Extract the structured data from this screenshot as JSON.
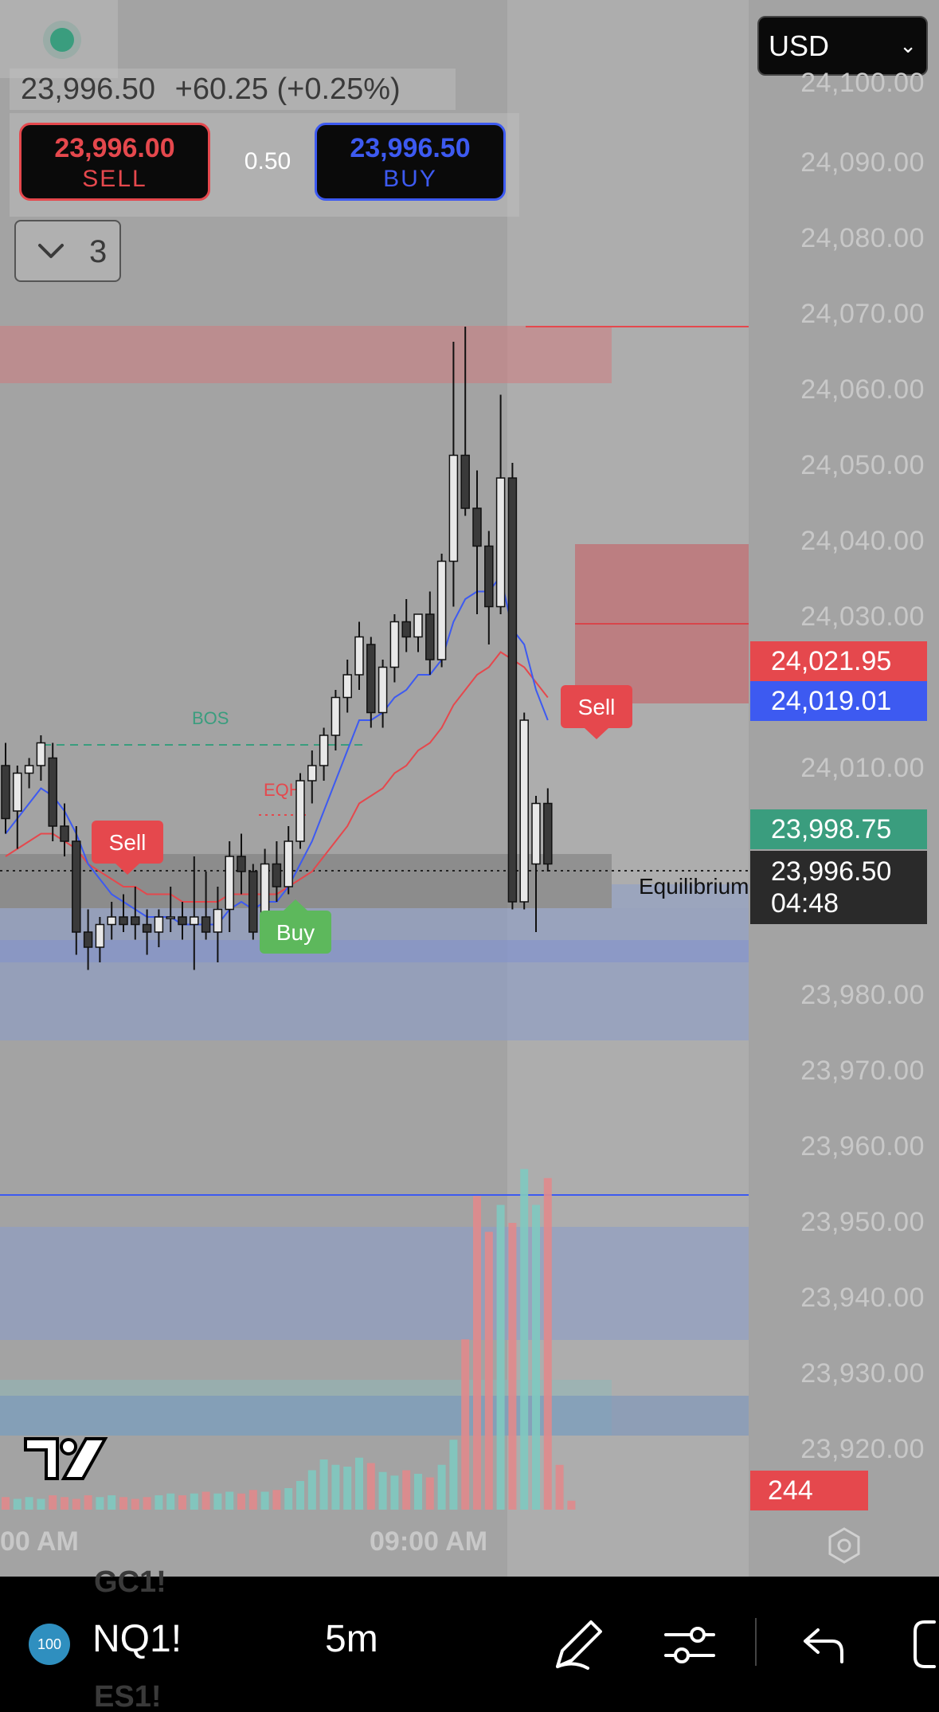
{
  "currency": {
    "value": "USD"
  },
  "quote": {
    "last": "23,996.50",
    "change": "+60.25 (+0.25%)"
  },
  "trade": {
    "sell_price": "23,996.00",
    "sell_label": "SELL",
    "spread": "0.50",
    "buy_price": "23,996.50",
    "buy_label": "BUY"
  },
  "layers": {
    "count": "3"
  },
  "price_axis": [
    "24,100.00",
    "24,090.00",
    "24,080.00",
    "24,070.00",
    "24,060.00",
    "24,050.00",
    "24,040.00",
    "24,030.00",
    "24,010.00",
    "23,980.00",
    "23,970.00",
    "23,960.00",
    "23,950.00",
    "23,940.00",
    "23,930.00",
    "23,920.00"
  ],
  "badges": {
    "red_ma": "24,021.95",
    "blue_ma": "24,019.01",
    "green_price": "23,998.75",
    "last_price": "23,996.50",
    "countdown": "04:48",
    "volume": "244"
  },
  "time_axis": {
    "left": "00 AM",
    "center": "09:00 AM"
  },
  "bottom_bar": {
    "symbol_badge": "100",
    "symbol": "NQ1!",
    "timeframe": "5m",
    "ghost_above": "GC1!",
    "ghost_below": "ES1!"
  },
  "colors": {
    "sell": "#e5484d",
    "buy": "#3d5af1",
    "up_green": "#3a9d7e",
    "background": "#a3a3a3"
  },
  "chart_data": {
    "type": "candlestick",
    "symbol": "NQ1!",
    "interval": "5m",
    "ylim": [
      23915,
      24105
    ],
    "annotations": [
      "BOS",
      "EQH",
      "Sell",
      "Buy",
      "Sell",
      "Equilibrium"
    ],
    "candles": [
      {
        "o": 24012,
        "h": 24015,
        "l": 24003,
        "c": 24005
      },
      {
        "o": 24006,
        "h": 24012,
        "l": 24001,
        "c": 24011
      },
      {
        "o": 24011,
        "h": 24013,
        "l": 24009,
        "c": 24012
      },
      {
        "o": 24012,
        "h": 24016,
        "l": 24010,
        "c": 24015
      },
      {
        "o": 24013,
        "h": 24015,
        "l": 24002,
        "c": 24004
      },
      {
        "o": 24004,
        "h": 24007,
        "l": 24000,
        "c": 24002
      },
      {
        "o": 24002,
        "h": 24004,
        "l": 23987,
        "c": 23990
      },
      {
        "o": 23990,
        "h": 23993,
        "l": 23985,
        "c": 23988
      },
      {
        "o": 23988,
        "h": 23992,
        "l": 23986,
        "c": 23991
      },
      {
        "o": 23991,
        "h": 23994,
        "l": 23989,
        "c": 23992
      },
      {
        "o": 23992,
        "h": 23995,
        "l": 23990,
        "c": 23991
      },
      {
        "o": 23992,
        "h": 23996,
        "l": 23989,
        "c": 23991
      },
      {
        "o": 23991,
        "h": 23993,
        "l": 23987,
        "c": 23990
      },
      {
        "o": 23990,
        "h": 23993,
        "l": 23988,
        "c": 23992
      },
      {
        "o": 23992,
        "h": 23996,
        "l": 23990,
        "c": 23992
      },
      {
        "o": 23992,
        "h": 23994,
        "l": 23989,
        "c": 23991
      },
      {
        "o": 23991,
        "h": 24000,
        "l": 23985,
        "c": 23992
      },
      {
        "o": 23992,
        "h": 23998,
        "l": 23989,
        "c": 23990
      },
      {
        "o": 23990,
        "h": 23996,
        "l": 23986,
        "c": 23993
      },
      {
        "o": 23993,
        "h": 24002,
        "l": 23990,
        "c": 24000
      },
      {
        "o": 24000,
        "h": 24003,
        "l": 23995,
        "c": 23998
      },
      {
        "o": 23998,
        "h": 23999,
        "l": 23989,
        "c": 23990
      },
      {
        "o": 23991,
        "h": 24001,
        "l": 23990,
        "c": 23999
      },
      {
        "o": 23999,
        "h": 24002,
        "l": 23994,
        "c": 23996
      },
      {
        "o": 23996,
        "h": 24004,
        "l": 23995,
        "c": 24002
      },
      {
        "o": 24002,
        "h": 24011,
        "l": 24001,
        "c": 24010
      },
      {
        "o": 24010,
        "h": 24014,
        "l": 24007,
        "c": 24012
      },
      {
        "o": 24012,
        "h": 24017,
        "l": 24010,
        "c": 24016
      },
      {
        "o": 24016,
        "h": 24022,
        "l": 24014,
        "c": 24021
      },
      {
        "o": 24021,
        "h": 24026,
        "l": 24019,
        "c": 24024
      },
      {
        "o": 24024,
        "h": 24031,
        "l": 24022,
        "c": 24029
      },
      {
        "o": 24028,
        "h": 24029,
        "l": 24017,
        "c": 24019
      },
      {
        "o": 24019,
        "h": 24026,
        "l": 24017,
        "c": 24025
      },
      {
        "o": 24025,
        "h": 24032,
        "l": 24023,
        "c": 24031
      },
      {
        "o": 24031,
        "h": 24034,
        "l": 24027,
        "c": 24029
      },
      {
        "o": 24029,
        "h": 24032,
        "l": 24027,
        "c": 24032
      },
      {
        "o": 24032,
        "h": 24035,
        "l": 24024,
        "c": 24026
      },
      {
        "o": 24026,
        "h": 24040,
        "l": 24025,
        "c": 24039
      },
      {
        "o": 24039,
        "h": 24068,
        "l": 24033,
        "c": 24053
      },
      {
        "o": 24053,
        "h": 24070,
        "l": 24045,
        "c": 24046
      },
      {
        "o": 24046,
        "h": 24051,
        "l": 24032,
        "c": 24041
      },
      {
        "o": 24041,
        "h": 24043,
        "l": 24028,
        "c": 24033
      },
      {
        "o": 24033,
        "h": 24061,
        "l": 24032,
        "c": 24050
      },
      {
        "o": 24050,
        "h": 24052,
        "l": 23993,
        "c": 23994
      },
      {
        "o": 23994,
        "h": 24019,
        "l": 23993,
        "c": 24018
      },
      {
        "o": 23999,
        "h": 24008,
        "l": 23990,
        "c": 24007
      },
      {
        "o": 24007,
        "h": 24009,
        "l": 23998,
        "c": 23999
      }
    ],
    "ema_fast": [
      24003,
      24005,
      24007,
      24009,
      24008,
      24006,
      24003,
      23999,
      23997,
      23995,
      23994,
      23993,
      23992,
      23992,
      23992,
      23991,
      23991,
      23991,
      23991,
      23993,
      23994,
      23993,
      23994,
      23994,
      23996,
      23999,
      24002,
      24006,
      24010,
      24014,
      24018,
      24018,
      24019,
      24021,
      24022,
      24024,
      24024,
      24026,
      24031,
      24034,
      24035,
      24035,
      24037,
      24030,
      24028,
      24022,
      24018
    ],
    "ema_slow": [
      24000,
      24001,
      24002,
      24003,
      24003,
      24002,
      24001,
      23999,
      23998,
      23997,
      23996,
      23996,
      23995,
      23995,
      23995,
      23994,
      23994,
      23994,
      23994,
      23995,
      23995,
      23995,
      23995,
      23995,
      23996,
      23997,
      23998,
      24000,
      24002,
      24004,
      24007,
      24008,
      24009,
      24011,
      24012,
      24014,
      24015,
      24017,
      24020,
      24022,
      24024,
      24025,
      24027,
      24026,
      24025,
      24023,
      24021
    ],
    "volume": [
      7,
      6,
      7,
      6,
      8,
      7,
      6,
      8,
      7,
      8,
      7,
      6,
      7,
      8,
      9,
      8,
      9,
      10,
      9,
      10,
      9,
      11,
      10,
      11,
      12,
      16,
      22,
      28,
      25,
      24,
      29,
      26,
      21,
      19,
      22,
      20,
      18,
      25,
      39,
      95,
      175,
      155,
      170,
      160,
      190,
      170,
      185,
      25,
      5
    ]
  }
}
